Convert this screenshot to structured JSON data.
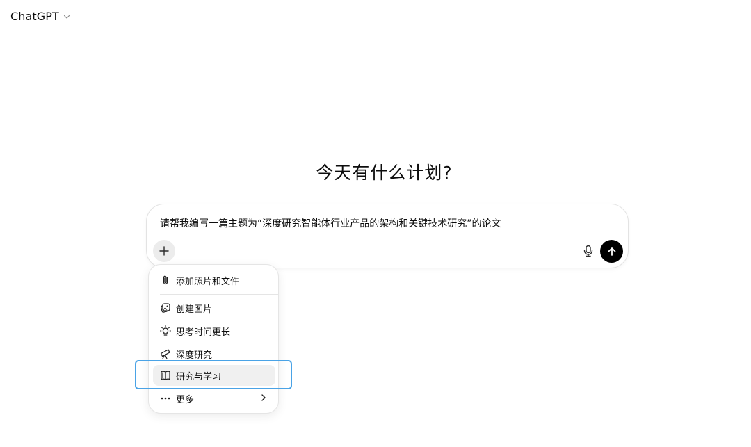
{
  "header": {
    "model_name": "ChatGPT",
    "model_chevron_icon": "chevron-down-icon"
  },
  "main": {
    "greeting": "今天有什么计划?"
  },
  "composer": {
    "text": "请帮我编写一篇主题为“深度研究智能体行业产品的架构和关键技术研究”的论文",
    "plus_icon": "plus-icon",
    "mic_icon": "microphone-icon",
    "send_icon": "arrow-up-icon"
  },
  "menu": {
    "items": [
      {
        "label": "添加照片和文件",
        "icon": "paperclip-icon"
      },
      {
        "label": "创建图片",
        "icon": "image-icon"
      },
      {
        "label": "思考时间更长",
        "icon": "lightbulb-icon"
      },
      {
        "label": "深度研究",
        "icon": "telescope-icon"
      },
      {
        "label": "研究与学习",
        "icon": "book-open-icon",
        "selected": true
      },
      {
        "label": "更多",
        "icon": "more-dots-icon",
        "submenu_icon": "chevron-right-icon"
      }
    ]
  },
  "colors": {
    "highlight": "#4aa3e6",
    "send_button": "#000000",
    "selected_item_bg": "#f0f0f0"
  }
}
